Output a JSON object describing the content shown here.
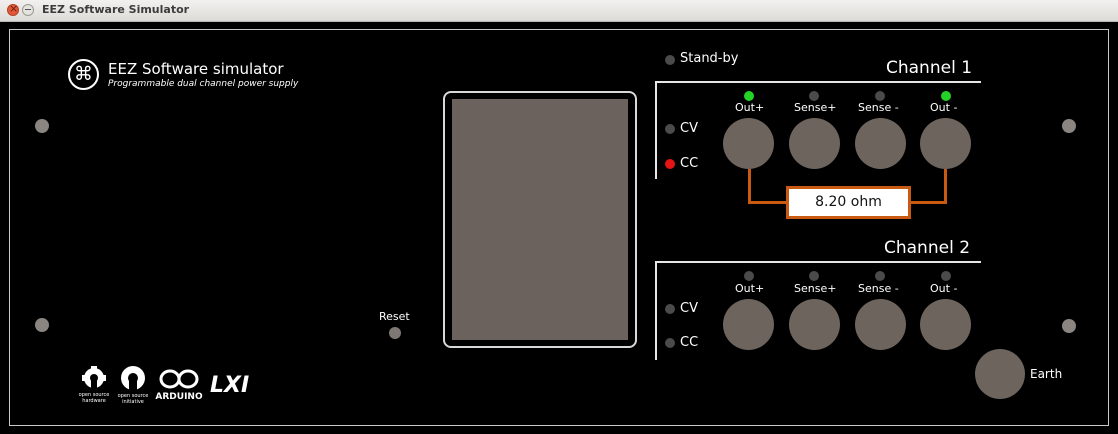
{
  "window": {
    "title": "EEZ Software Simulator"
  },
  "brand": {
    "title": "EEZ Software simulator",
    "subtitle": "Programmable dual channel power supply"
  },
  "standby": {
    "label": "Stand-by"
  },
  "reset": {
    "label": "Reset"
  },
  "channel1": {
    "title": "Channel 1",
    "terminals": [
      "Out+",
      "Sense+",
      "Sense -",
      "Out -"
    ],
    "cv_label": "CV",
    "cc_label": "CC",
    "load": "8.20 ohm",
    "cc_active": true
  },
  "channel2": {
    "title": "Channel 2",
    "terminals": [
      "Out+",
      "Sense+",
      "Sense -",
      "Out -"
    ],
    "cv_label": "CV",
    "cc_label": "CC"
  },
  "earth": {
    "label": "Earth"
  },
  "logos": {
    "oshw_line1": "open source",
    "oshw_line2": "hardware",
    "osi_line1": "open source",
    "osi_line2": "initiative",
    "arduino": "ARDUINO",
    "lxi": "LXI"
  },
  "colors": {
    "panel": "#000000",
    "terminal": "#6d645e",
    "led_on_green": "#24d326",
    "led_on_red": "#e41414",
    "wire": "#c95a12"
  }
}
